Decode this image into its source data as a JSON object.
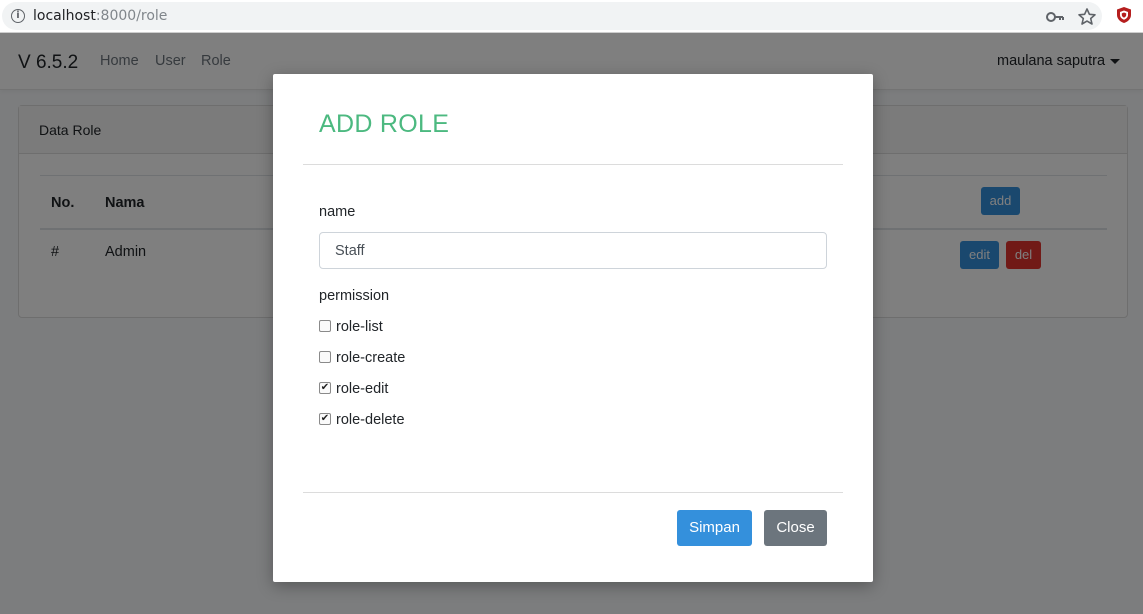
{
  "browser": {
    "url_host": "localhost",
    "url_path": ":8000/role"
  },
  "navbar": {
    "brand": "V 6.5.2",
    "links": [
      "Home",
      "User",
      "Role"
    ],
    "user_name": "maulana saputra"
  },
  "card": {
    "title": "Data Role",
    "columns": [
      "No.",
      "Nama"
    ],
    "add_label": "add",
    "rows": [
      {
        "no": "#",
        "nama": "Admin",
        "edit_label": "edit",
        "del_label": "del"
      }
    ]
  },
  "modal": {
    "title": "ADD ROLE",
    "name_label": "name",
    "name_value": "Staff",
    "permission_label": "permission",
    "permissions": [
      {
        "label": "role-list",
        "checked": false
      },
      {
        "label": "role-create",
        "checked": false
      },
      {
        "label": "role-edit",
        "checked": true
      },
      {
        "label": "role-delete",
        "checked": true
      }
    ],
    "save_label": "Simpan",
    "close_label": "Close"
  },
  "colors": {
    "accent": "#4cb980",
    "primary": "#3490dc",
    "danger": "#e3342f",
    "secondary": "#6c757d"
  }
}
